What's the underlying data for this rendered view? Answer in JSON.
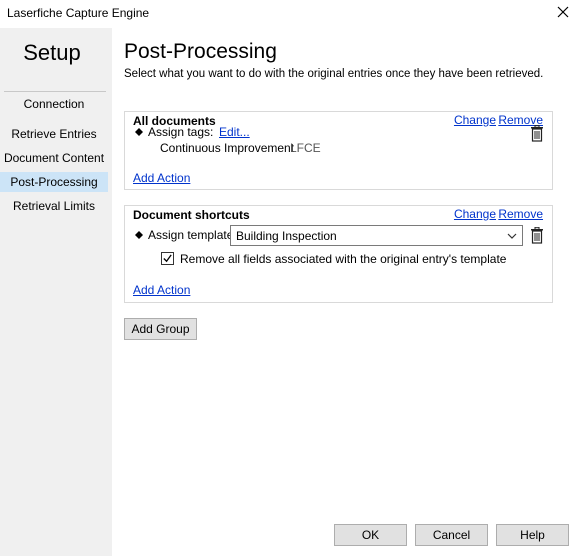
{
  "window": {
    "title": "Laserfiche Capture Engine"
  },
  "sidebar": {
    "header": "Setup",
    "items": [
      {
        "label": "Connection"
      },
      {
        "label": "Retrieve Entries"
      },
      {
        "label": "Document Content"
      },
      {
        "label": "Post-Processing",
        "selected": true
      },
      {
        "label": "Retrieval Limits"
      }
    ]
  },
  "page": {
    "title": "Post-Processing",
    "subtitle": "Select what you want to do with the original entries once they have been retrieved."
  },
  "groups": [
    {
      "title": "All documents",
      "change_label": "Change",
      "remove_label": "Remove",
      "action": {
        "label": "Assign tags:",
        "edit_label": "Edit...",
        "tag_name": "Continuous Improvement",
        "tag_code": "LFCE"
      },
      "add_action_label": "Add Action"
    },
    {
      "title": "Document shortcuts",
      "change_label": "Change",
      "remove_label": "Remove",
      "action": {
        "label": "Assign template:",
        "template_value": "Building Inspection",
        "checkbox_label": "Remove all fields associated with the original entry's template",
        "checkbox_checked": true
      },
      "add_action_label": "Add Action"
    }
  ],
  "add_group_label": "Add Group",
  "footer": {
    "ok_label": "OK",
    "cancel_label": "Cancel",
    "help_label": "Help"
  },
  "colors": {
    "link": "#0033cc",
    "sidebar_bg": "#f0f0f0",
    "selected_bg": "#cce4f7",
    "button_bg": "#e1e1e1"
  }
}
